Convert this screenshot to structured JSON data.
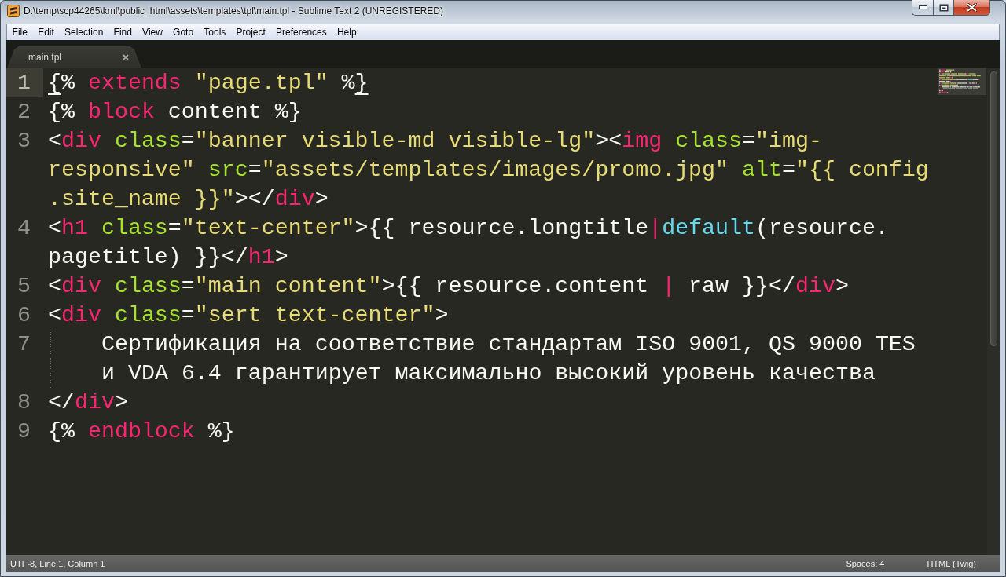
{
  "window": {
    "title": "D:\\temp\\scp44265\\kml\\public_html\\assets\\templates\\tpl\\main.tpl - Sublime Text 2 (UNREGISTERED)"
  },
  "menu_bar": {
    "items": [
      "File",
      "Edit",
      "Selection",
      "Find",
      "View",
      "Goto",
      "Tools",
      "Project",
      "Preferences",
      "Help"
    ]
  },
  "tabs": [
    {
      "label": "main.tpl",
      "selected": true
    }
  ],
  "editor": {
    "lines": [
      {
        "number": "1",
        "current": true,
        "rows": [
          {
            "indented": false,
            "tokens": [
              {
                "text": "{",
                "kind": "plain",
                "matched": true
              },
              {
                "text": "% ",
                "kind": "plain",
                "matched": false
              },
              {
                "text": "extends",
                "kind": "keyword",
                "matched": false
              },
              {
                "text": " \"page.tpl\"",
                "kind": "string",
                "matched": false
              },
              {
                "text": " %",
                "kind": "plain",
                "matched": false
              },
              {
                "text": "}",
                "kind": "plain",
                "matched": true
              }
            ]
          }
        ]
      },
      {
        "number": "2",
        "current": false,
        "rows": [
          {
            "indented": false,
            "tokens": [
              {
                "text": "{% ",
                "kind": "plain",
                "matched": false
              },
              {
                "text": "block",
                "kind": "keyword",
                "matched": false
              },
              {
                "text": " content %}",
                "kind": "plain",
                "matched": false
              }
            ]
          }
        ]
      },
      {
        "number": "3",
        "current": false,
        "rows": [
          {
            "indented": false,
            "tokens": [
              {
                "text": "<",
                "kind": "plain",
                "matched": false
              },
              {
                "text": "div",
                "kind": "tag",
                "matched": false
              },
              {
                "text": " class",
                "kind": "attribute",
                "matched": false
              },
              {
                "text": "=",
                "kind": "plain",
                "matched": false
              },
              {
                "text": "\"banner visible-md visible-lg\"",
                "kind": "string",
                "matched": false
              },
              {
                "text": "><",
                "kind": "plain",
                "matched": false
              },
              {
                "text": "img",
                "kind": "tag",
                "matched": false
              },
              {
                "text": " class",
                "kind": "attribute",
                "matched": false
              },
              {
                "text": "=",
                "kind": "plain",
                "matched": false
              },
              {
                "text": "\"img-",
                "kind": "string",
                "matched": false
              }
            ]
          },
          {
            "indented": false,
            "tokens": [
              {
                "text": "responsive\"",
                "kind": "string",
                "matched": false
              },
              {
                "text": " src",
                "kind": "attribute",
                "matched": false
              },
              {
                "text": "=",
                "kind": "plain",
                "matched": false
              },
              {
                "text": "\"assets/templates/images/promo.jpg\"",
                "kind": "string",
                "matched": false
              },
              {
                "text": " alt",
                "kind": "attribute",
                "matched": false
              },
              {
                "text": "=",
                "kind": "plain",
                "matched": false
              },
              {
                "text": "\"{{ config",
                "kind": "string",
                "matched": false
              }
            ]
          },
          {
            "indented": false,
            "tokens": [
              {
                "text": ".site_name }}\"",
                "kind": "string",
                "matched": false
              },
              {
                "text": "></",
                "kind": "plain",
                "matched": false
              },
              {
                "text": "div",
                "kind": "tag",
                "matched": false
              },
              {
                "text": ">",
                "kind": "plain",
                "matched": false
              }
            ]
          }
        ]
      },
      {
        "number": "4",
        "current": false,
        "rows": [
          {
            "indented": false,
            "tokens": [
              {
                "text": "<",
                "kind": "plain",
                "matched": false
              },
              {
                "text": "h1",
                "kind": "tag",
                "matched": false
              },
              {
                "text": " class",
                "kind": "attribute",
                "matched": false
              },
              {
                "text": "=",
                "kind": "plain",
                "matched": false
              },
              {
                "text": "\"text-center\"",
                "kind": "string",
                "matched": false
              },
              {
                "text": ">{{ resource.longtitle",
                "kind": "plain",
                "matched": false
              },
              {
                "text": "|",
                "kind": "operator",
                "matched": false
              },
              {
                "text": "default",
                "kind": "function",
                "matched": false
              },
              {
                "text": "(resource.",
                "kind": "plain",
                "matched": false
              }
            ]
          },
          {
            "indented": false,
            "tokens": [
              {
                "text": "pagetitle) }}</",
                "kind": "plain",
                "matched": false
              },
              {
                "text": "h1",
                "kind": "tag",
                "matched": false
              },
              {
                "text": ">",
                "kind": "plain",
                "matched": false
              }
            ]
          }
        ]
      },
      {
        "number": "5",
        "current": false,
        "rows": [
          {
            "indented": false,
            "tokens": [
              {
                "text": "<",
                "kind": "plain",
                "matched": false
              },
              {
                "text": "div",
                "kind": "tag",
                "matched": false
              },
              {
                "text": " class",
                "kind": "attribute",
                "matched": false
              },
              {
                "text": "=",
                "kind": "plain",
                "matched": false
              },
              {
                "text": "\"main content\"",
                "kind": "string",
                "matched": false
              },
              {
                "text": ">{{ resource.content ",
                "kind": "plain",
                "matched": false
              },
              {
                "text": "|",
                "kind": "operator",
                "matched": false
              },
              {
                "text": " raw }}</",
                "kind": "plain",
                "matched": false
              },
              {
                "text": "div",
                "kind": "tag",
                "matched": false
              },
              {
                "text": ">",
                "kind": "plain",
                "matched": false
              }
            ]
          }
        ]
      },
      {
        "number": "6",
        "current": false,
        "rows": [
          {
            "indented": false,
            "tokens": [
              {
                "text": "<",
                "kind": "plain",
                "matched": false
              },
              {
                "text": "div",
                "kind": "tag",
                "matched": false
              },
              {
                "text": " class",
                "kind": "attribute",
                "matched": false
              },
              {
                "text": "=",
                "kind": "plain",
                "matched": false
              },
              {
                "text": "\"sert text-center\"",
                "kind": "string",
                "matched": false
              },
              {
                "text": ">",
                "kind": "plain",
                "matched": false
              }
            ]
          }
        ]
      },
      {
        "number": "7",
        "current": false,
        "rows": [
          {
            "indented": true,
            "tokens": [
              {
                "text": "Сертификация на соответствие стандартам ISO 9001, QS 9000 TES",
                "kind": "plain",
                "matched": false
              }
            ]
          },
          {
            "indented": true,
            "tokens": [
              {
                "text": "и VDA 6.4 гарантирует максимально высокий уровень качества",
                "kind": "plain",
                "matched": false
              }
            ]
          }
        ]
      },
      {
        "number": "8",
        "current": false,
        "rows": [
          {
            "indented": false,
            "tokens": [
              {
                "text": "</",
                "kind": "plain",
                "matched": false
              },
              {
                "text": "div",
                "kind": "tag",
                "matched": false
              },
              {
                "text": ">",
                "kind": "plain",
                "matched": false
              }
            ]
          }
        ]
      },
      {
        "number": "9",
        "current": false,
        "rows": [
          {
            "indented": false,
            "tokens": [
              {
                "text": "{% ",
                "kind": "plain",
                "matched": false
              },
              {
                "text": "endblock",
                "kind": "keyword",
                "matched": false
              },
              {
                "text": " %}",
                "kind": "plain",
                "matched": false
              }
            ]
          }
        ]
      }
    ]
  },
  "status_bar": {
    "position": "UTF-8, Line 1, Column 1",
    "indentation": "Spaces: 4",
    "syntax": "HTML (Twig)"
  }
}
